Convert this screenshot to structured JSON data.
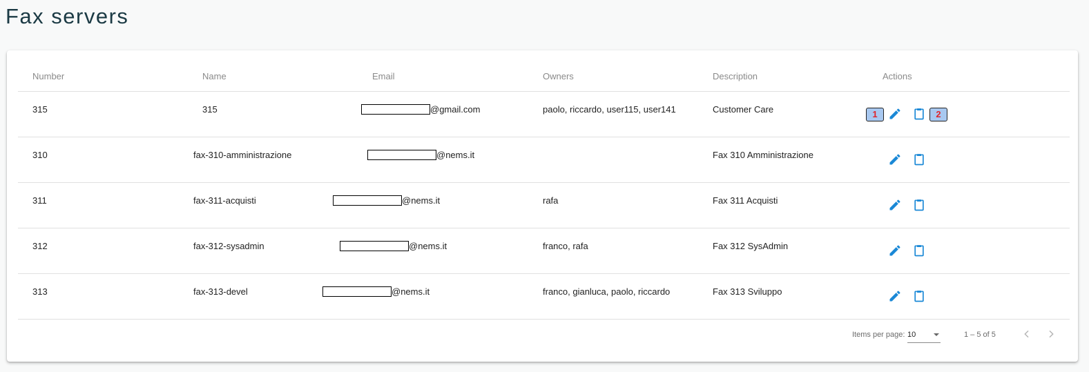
{
  "page": {
    "title": "Fax servers"
  },
  "table": {
    "headers": {
      "number": "Number",
      "name": "Name",
      "email": "Email",
      "owners": "Owners",
      "description": "Description",
      "actions": "Actions"
    },
    "rows": [
      {
        "number": "315",
        "name": "315",
        "email_domain": "@gmail.com",
        "owners": "paolo, riccardo, user115, user141",
        "description": "Customer Care"
      },
      {
        "number": "310",
        "name": "fax-310-amministrazione",
        "email_domain": "@nems.it",
        "owners": "",
        "description": "Fax 310 Amministrazione"
      },
      {
        "number": "311",
        "name": "fax-311-acquisti",
        "email_domain": "@nems.it",
        "owners": "rafa",
        "description": "Fax 311 Acquisti"
      },
      {
        "number": "312",
        "name": "fax-312-sysadmin",
        "email_domain": "@nems.it",
        "owners": "franco, rafa",
        "description": "Fax 312 SysAdmin"
      },
      {
        "number": "313",
        "name": "fax-313-devel",
        "email_domain": "@nems.it",
        "owners": "franco, gianluca, paolo, riccardo",
        "description": "Fax 313 Sviluppo"
      }
    ],
    "action_icons": [
      "edit-pencil-icon",
      "clipboard-icon"
    ]
  },
  "annotations": {
    "badge_1": "1",
    "badge_2": "2"
  },
  "paginator": {
    "items_per_page_label": "Items per page:",
    "items_per_page_value": "10",
    "range_label": "1 – 5 of 5"
  },
  "colors": {
    "accent": "#1a88d6",
    "title": "#1b3a44",
    "badge_bg": "#a8c8f0",
    "badge_text": "#e0242a"
  }
}
